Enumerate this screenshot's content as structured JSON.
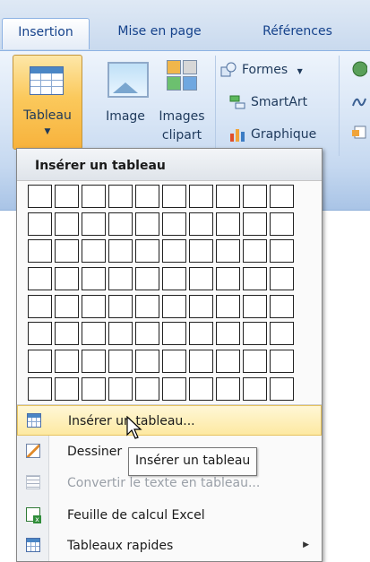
{
  "ribbon": {
    "tabs": [
      {
        "label": "Insertion",
        "active": true
      },
      {
        "label": "Mise en page",
        "active": false
      },
      {
        "label": "Références",
        "active": false
      }
    ],
    "buttons": {
      "tableau": "Tableau",
      "image": "Image",
      "images_line1": "Images",
      "images_line2": "clipart",
      "formes": "Formes",
      "smartart": "SmartArt",
      "graphique": "Graphique"
    }
  },
  "dropdown": {
    "heading": "Insérer un tableau",
    "grid": {
      "columns": 10,
      "rows": 8
    },
    "items": [
      {
        "label": "Insérer un tableau...",
        "icon": "table-icon",
        "highlighted": true,
        "disabled": false
      },
      {
        "label": "Dessiner",
        "icon": "pencil-icon",
        "highlighted": false,
        "disabled": false
      },
      {
        "label": "Convertir le texte en tableau...",
        "icon": "convert-icon",
        "highlighted": false,
        "disabled": true
      },
      {
        "label": "Feuille de calcul Excel",
        "icon": "excel-icon",
        "highlighted": false,
        "disabled": false
      },
      {
        "label": "Tableaux rapides",
        "icon": "quick-tables-icon",
        "highlighted": false,
        "disabled": false,
        "submenu": true
      }
    ]
  },
  "tooltip": "Insérer un tableau",
  "colors": {
    "ribbon_blue": "#c5d8f0",
    "tableau_button_orange": "#fbc95c",
    "highlight_yellow": "#fde9a2",
    "tab_text": "#15428b"
  }
}
